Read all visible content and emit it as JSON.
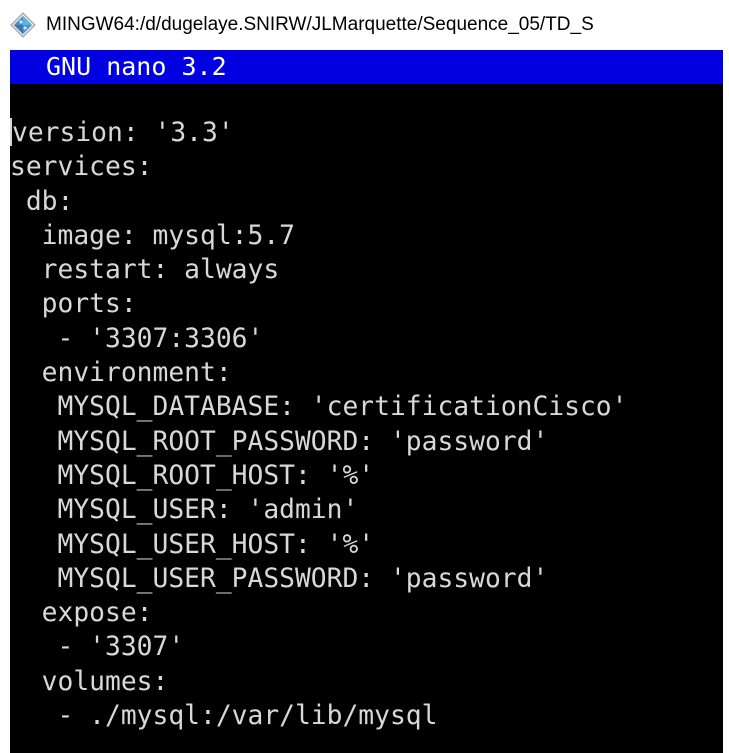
{
  "window": {
    "title": "MINGW64:/d/dugelaye.SNIRW/JLMarquette/Sequence_05/TD_S",
    "icon": "git-bash-icon"
  },
  "editor": {
    "header": "GNU nano 3.2",
    "lines": [
      "version: '3.3'",
      "services:",
      " db:",
      "  image: mysql:5.7",
      "  restart: always",
      "  ports:",
      "   - '3307:3306'",
      "  environment:",
      "   MYSQL_DATABASE: 'certificationCisco'",
      "   MYSQL_ROOT_PASSWORD: 'password'",
      "   MYSQL_ROOT_HOST: '%'",
      "   MYSQL_USER: 'admin'",
      "   MYSQL_USER_HOST: '%'",
      "   MYSQL_USER_PASSWORD: 'password'",
      "  expose:",
      "   - '3307'",
      "  volumes:",
      "   - ./mysql:/var/lib/mysql"
    ]
  }
}
